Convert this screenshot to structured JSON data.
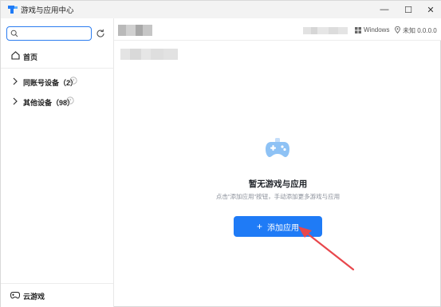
{
  "window": {
    "title": "游戏与应用中心",
    "minimize_glyph": "—",
    "maximize_glyph": "☐",
    "close_glyph": "✕"
  },
  "sidebar": {
    "search": {
      "value": "",
      "placeholder": ""
    },
    "home_label": "首页",
    "groups": [
      {
        "label": "同账号设备（2）"
      },
      {
        "label": "其他设备（98）"
      }
    ],
    "cloud_label": "云游戏"
  },
  "header": {
    "os_label": "Windows",
    "location_label": "未知 0.0.0.0"
  },
  "empty_state": {
    "title": "暂无游戏与应用",
    "description": "点击\"添加应用\"按钮，手动添加更多游戏与应用",
    "button_label": "添加应用"
  },
  "colors": {
    "accent": "#1f7bf6",
    "gamepad": "#8ec2f5",
    "annotation_arrow": "#e8474c"
  }
}
